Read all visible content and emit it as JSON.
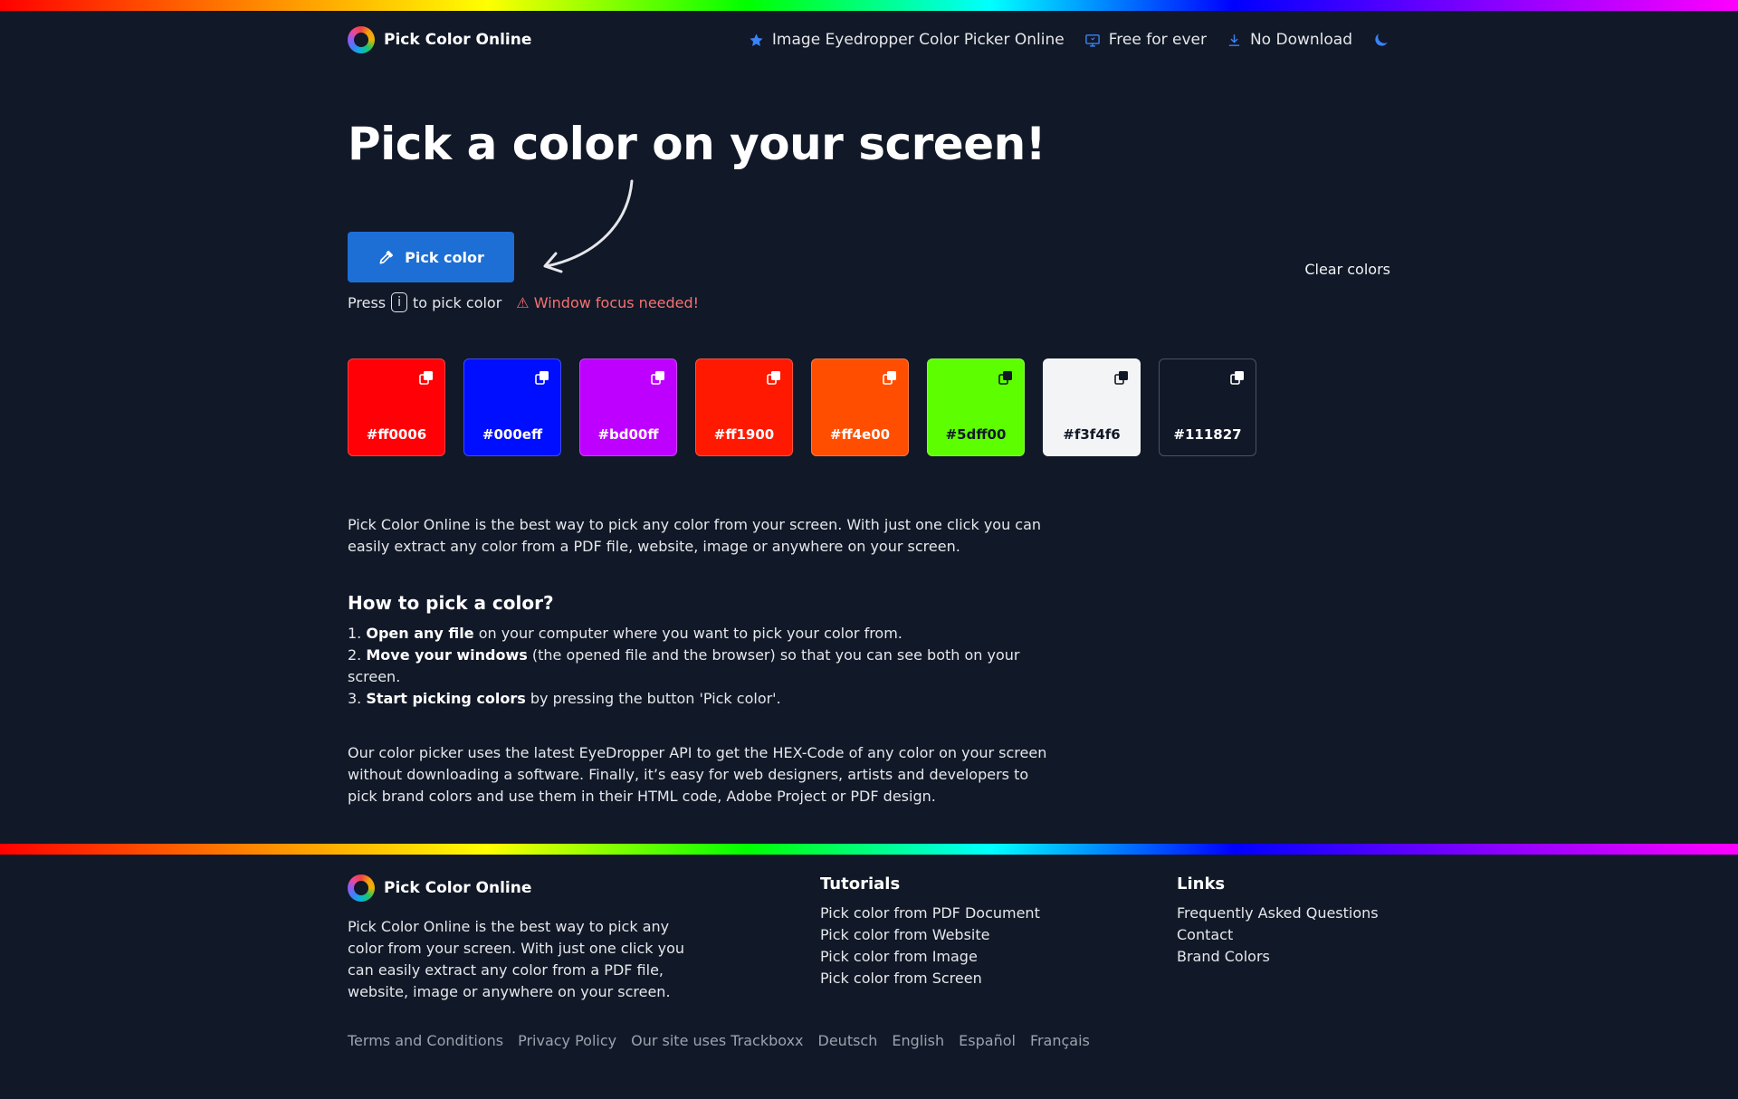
{
  "header": {
    "brand": "Pick Color Online",
    "nav": [
      {
        "label": "Image Eyedropper Color Picker Online",
        "icon": "star-icon"
      },
      {
        "label": "Free for ever",
        "icon": "monitor-icon"
      },
      {
        "label": "No Download",
        "icon": "download-icon"
      }
    ],
    "theme_icon": "moon-icon"
  },
  "hero": {
    "title": "Pick a color on your screen!",
    "button_label": "Pick color",
    "hint_prefix": "Press",
    "hint_key": "i",
    "hint_suffix": "to pick color",
    "warning": "⚠ Window focus needed!",
    "clear_label": "Clear colors"
  },
  "swatches": [
    {
      "hex": "#ff0006",
      "text_color": "#ffffff"
    },
    {
      "hex": "#000eff",
      "text_color": "#ffffff"
    },
    {
      "hex": "#bd00ff",
      "text_color": "#ffffff"
    },
    {
      "hex": "#ff1900",
      "text_color": "#ffffff"
    },
    {
      "hex": "#ff4e00",
      "text_color": "#ffffff"
    },
    {
      "hex": "#5dff00",
      "text_color": "#111827"
    },
    {
      "hex": "#f3f4f6",
      "text_color": "#111827"
    },
    {
      "hex": "#111827",
      "text_color": "#ffffff"
    }
  ],
  "content": {
    "intro": "Pick Color Online is the best way to pick any color from your screen. With just one click you can easily extract any color from a PDF file, website, image or anywhere on your screen.",
    "how_title": "How to pick a color?",
    "steps": [
      {
        "num": "1.",
        "bold": "Open any file",
        "rest": " on your computer where you want to pick your color from."
      },
      {
        "num": "2.",
        "bold": "Move your windows",
        "rest": " (the opened file and the browser) so that you can see both on your screen."
      },
      {
        "num": "3.",
        "bold": "Start picking colors",
        "rest": " by pressing the button 'Pick color'."
      }
    ],
    "api_text": "Our color picker uses the latest EyeDropper API to get the HEX-Code of any color on your screen without downloading a software. Finally, it’s easy for web designers, artists and developers to pick brand colors and use them in their HTML code, Adobe Project or PDF design."
  },
  "footer": {
    "brand": "Pick Color Online",
    "description": "Pick Color Online is the best way to pick any color from your screen. With just one click you can easily extract any color from a PDF file, website, image or anywhere on your screen.",
    "tutorials_title": "Tutorials",
    "tutorials": [
      "Pick color from PDF Document",
      "Pick color from Website",
      "Pick color from Image",
      "Pick color from Screen"
    ],
    "links_title": "Links",
    "links": [
      "Frequently Asked Questions",
      "Contact",
      "Brand Colors"
    ],
    "bottom_links": [
      "Terms and Conditions",
      "Privacy Policy",
      "Our site uses Trackboxx",
      "Deutsch",
      "English",
      "Español",
      "Français"
    ]
  }
}
